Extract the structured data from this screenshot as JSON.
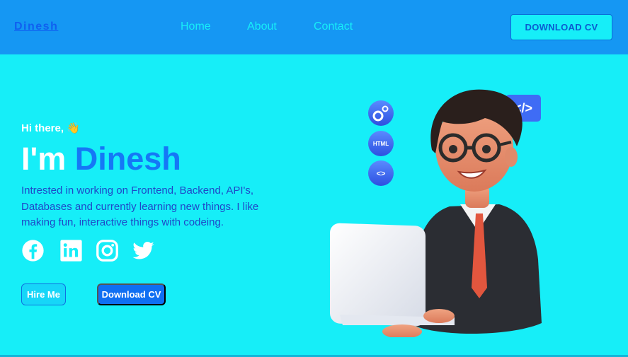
{
  "nav": {
    "brand": "Dinesh",
    "links": [
      "Home",
      "About",
      "Contact"
    ],
    "cv_button": "DOWNLOAD CV"
  },
  "hero": {
    "greeting": "Hi there, 👋",
    "headline_prefix": "I'm",
    "headline_name": "Dinesh",
    "description": "Intrested in working on Frontend, Backend, API's, Databases and currently learning new things. I like making fun, interactive things with codeing.",
    "hire_button": "Hire Me",
    "download_button": "Download CV",
    "badges": [
      "gears-icon",
      "HTML",
      "code-icon"
    ],
    "code_bubble": "</>"
  },
  "social": [
    "facebook-icon",
    "linkedin-icon",
    "instagram-icon",
    "twitter-icon"
  ],
  "colors": {
    "nav_bg": "#1597f3",
    "hero_bg": "#16eef8",
    "accent": "#1577f6",
    "text_blue": "#1f48c8"
  }
}
